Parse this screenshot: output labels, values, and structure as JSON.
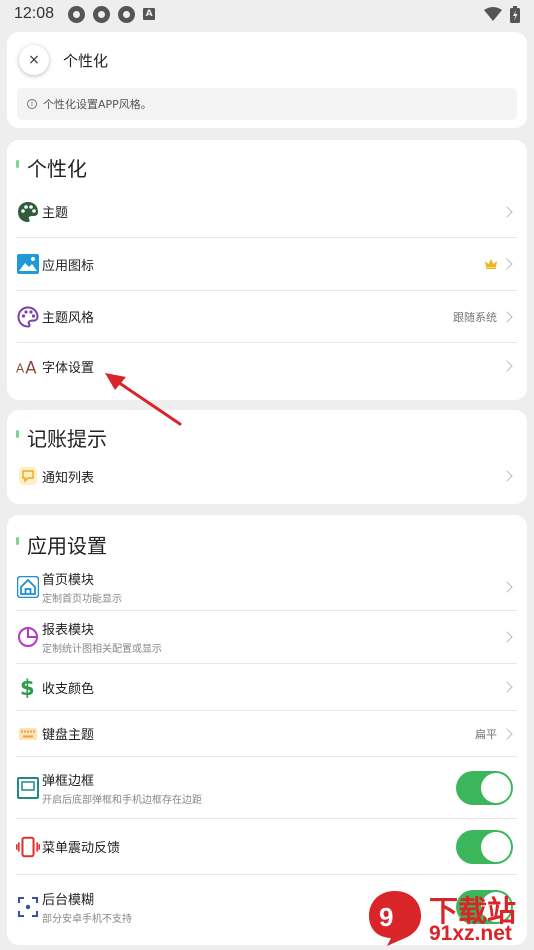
{
  "status_bar": {
    "time": "12:08",
    "badge": "A"
  },
  "header": {
    "close_glyph": "×",
    "title": "个性化",
    "info": "个性化设置APP风格。"
  },
  "sections": {
    "personal": {
      "title": "个性化",
      "items": [
        {
          "label": "主题",
          "icon": "palette-icon"
        },
        {
          "label": "应用图标",
          "icon": "image-icon",
          "badge": "crown-icon"
        },
        {
          "label": "主题风格",
          "icon": "palette-outline-icon",
          "value": "跟随系统"
        },
        {
          "label": "字体设置",
          "icon": "font-icon"
        }
      ]
    },
    "bookkeeping": {
      "title": "记账提示",
      "items": [
        {
          "label": "通知列表",
          "icon": "message-icon"
        }
      ]
    },
    "app": {
      "title": "应用设置",
      "items": [
        {
          "label": "首页模块",
          "sub": "定制首页功能显示",
          "icon": "home-icon"
        },
        {
          "label": "报表模块",
          "sub": "定制统计图相关配置或显示",
          "icon": "pie-chart-icon"
        },
        {
          "label": "收支颜色",
          "icon": "dollar-icon"
        },
        {
          "label": "键盘主题",
          "value": "扁平",
          "icon": "keyboard-icon"
        },
        {
          "label": "弹框边框",
          "sub": "开启后底部弹框和手机边框存在边距",
          "icon": "frame-icon",
          "toggle": true
        },
        {
          "label": "菜单震动反馈",
          "icon": "vibrate-icon",
          "toggle": true
        },
        {
          "label": "后台模糊",
          "sub": "部分安卓手机不支持",
          "icon": "blur-icon",
          "toggle": true
        }
      ]
    }
  },
  "watermark": {
    "brand": "下载站",
    "url": "91xz.net"
  },
  "colors": {
    "toggle_on": "#3bb65b",
    "accent": "#7fd39a",
    "arrow": "#d9242a"
  }
}
